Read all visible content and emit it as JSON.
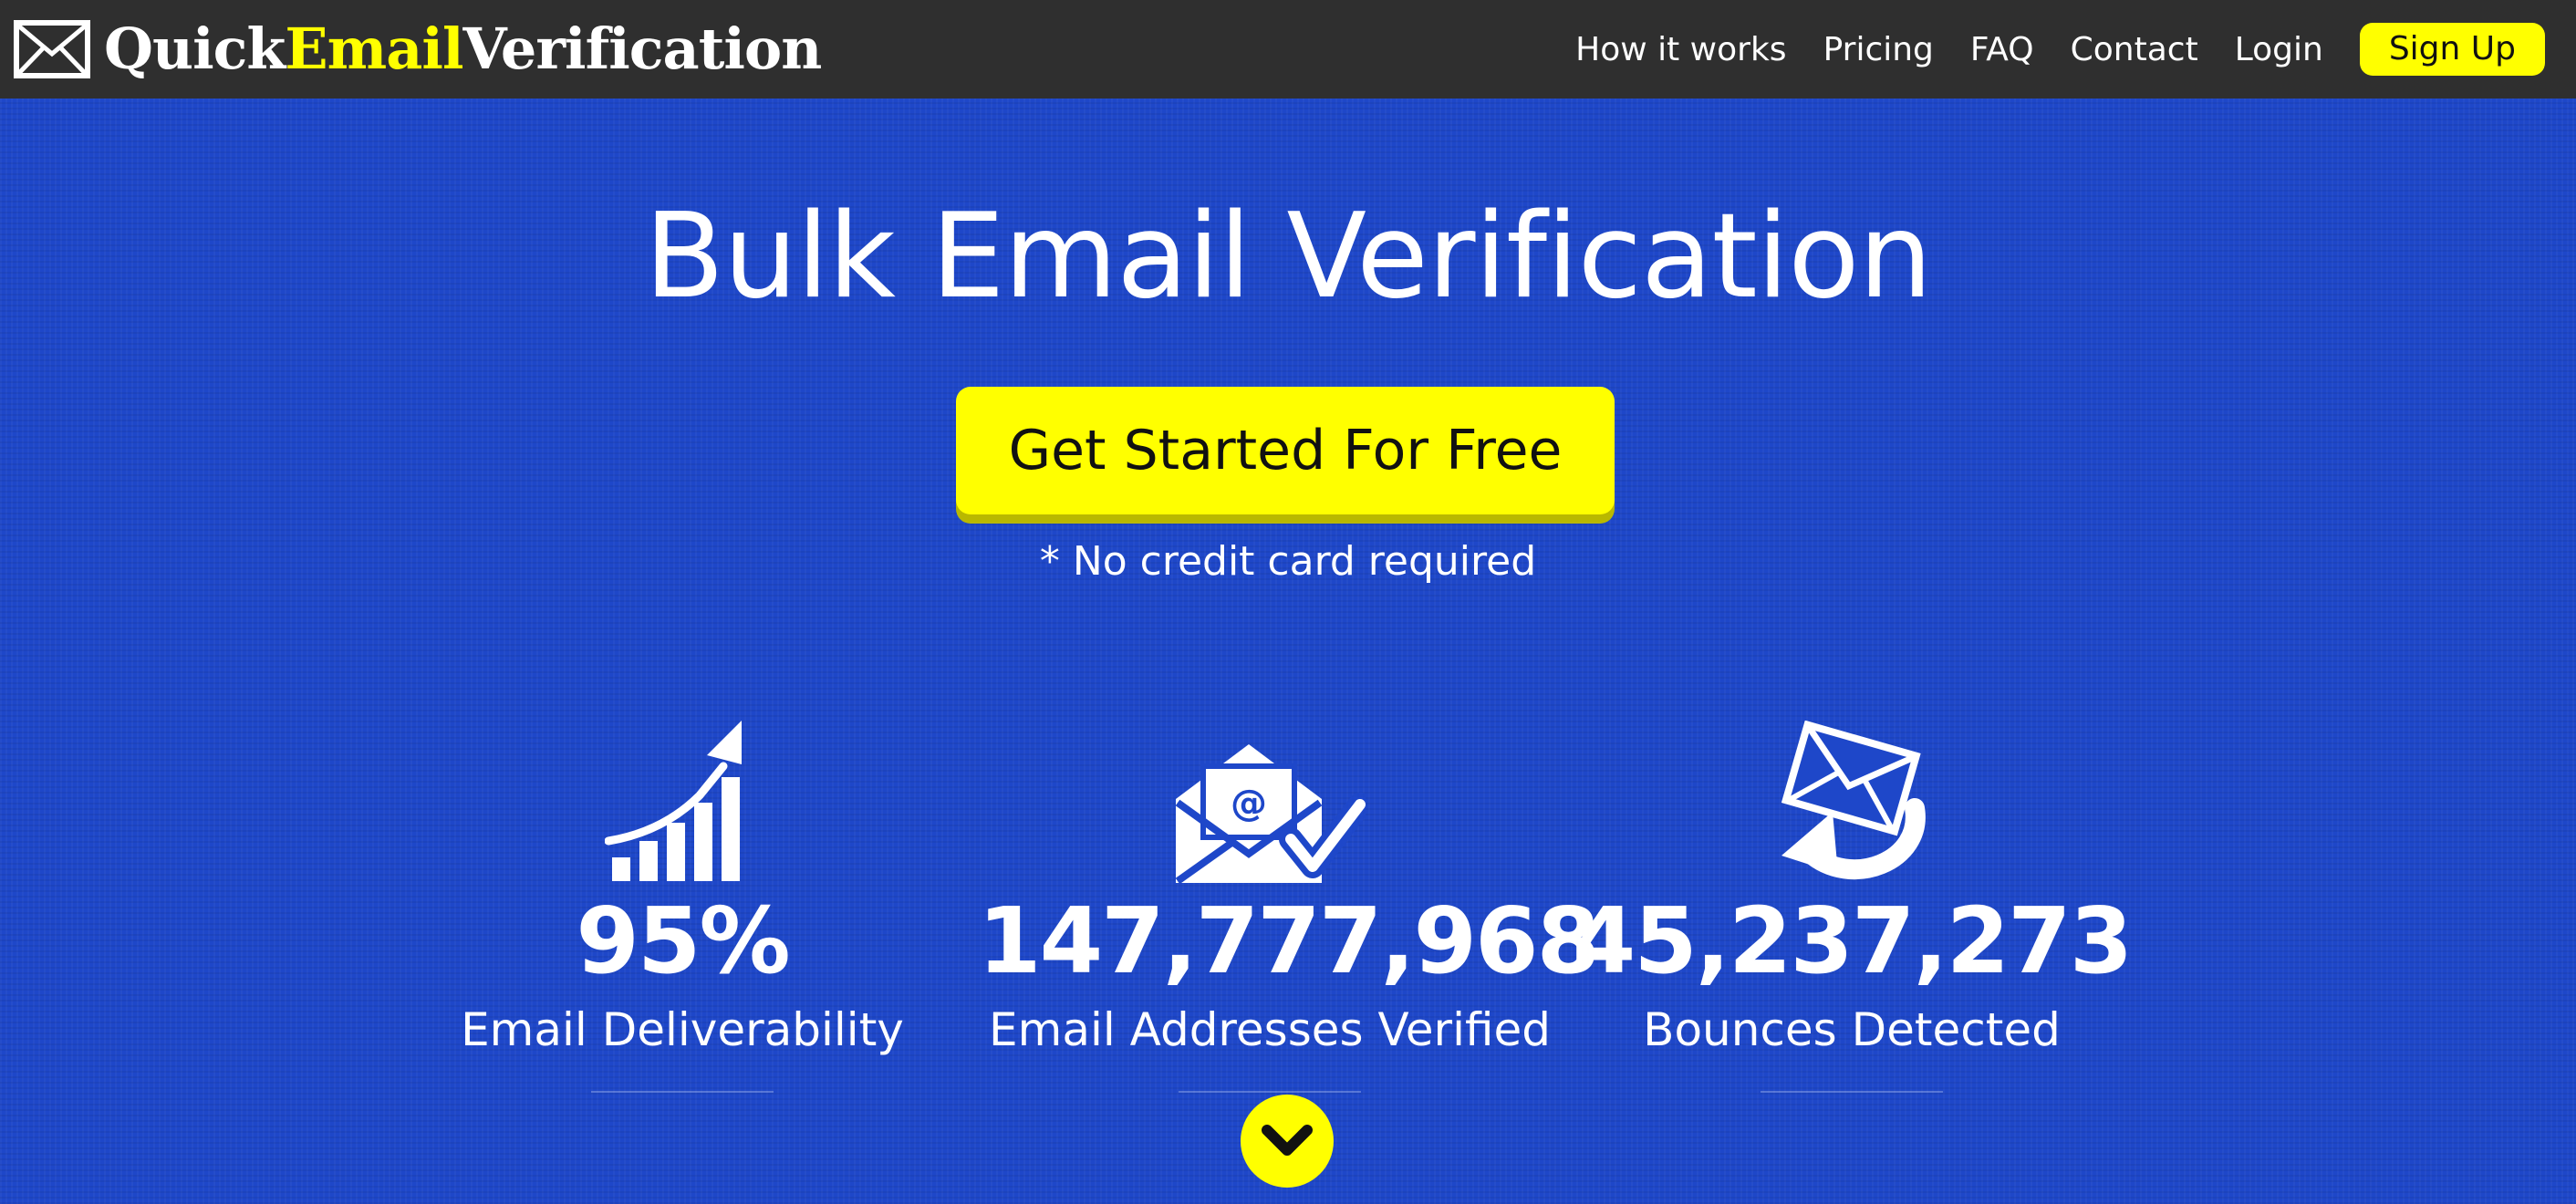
{
  "navbar": {
    "brand": {
      "part1": "Quick",
      "part2": "Email",
      "part3": "Verification",
      "icon": "envelope-icon"
    },
    "links": [
      "How it works",
      "Pricing",
      "FAQ",
      "Contact",
      "Login"
    ],
    "signup_label": "Sign Up"
  },
  "hero": {
    "title": "Bulk Email Verification",
    "cta_label": "Get Started For Free",
    "note": "* No credit card required"
  },
  "stats": [
    {
      "icon": "growth-chart-icon",
      "value": "95%",
      "label": "Email Deliverability"
    },
    {
      "icon": "envelope-verified-icon",
      "value": "147,777,968",
      "label": "Email Addresses Verified"
    },
    {
      "icon": "bounce-envelope-icon",
      "value": "45,237,273",
      "label": "Bounces Detected"
    }
  ],
  "scroll_icon": "chevron-down-icon",
  "colors": {
    "background": "#1e47c9",
    "navbar": "#2f2f2f",
    "accent": "#ffff00",
    "text": "#ffffff"
  }
}
